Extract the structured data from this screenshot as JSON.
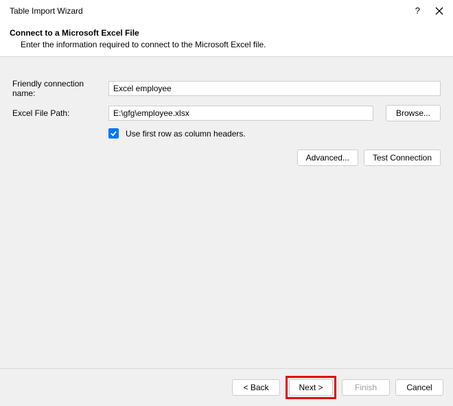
{
  "titlebar": {
    "title": "Table Import Wizard",
    "help": "?",
    "close": "×"
  },
  "header": {
    "title": "Connect to a Microsoft Excel File",
    "description": "Enter the information required to connect to the Microsoft Excel file."
  },
  "form": {
    "friendly_label": "Friendly connection name:",
    "friendly_value": "Excel employee",
    "path_label": "Excel File Path:",
    "path_value": "E:\\gfg\\employee.xlsx",
    "browse_label": "Browse...",
    "checkbox_label": "Use first row as column headers.",
    "advanced_label": "Advanced...",
    "test_label": "Test Connection"
  },
  "footer": {
    "back": "< Back",
    "next": "Next >",
    "finish": "Finish",
    "cancel": "Cancel"
  }
}
